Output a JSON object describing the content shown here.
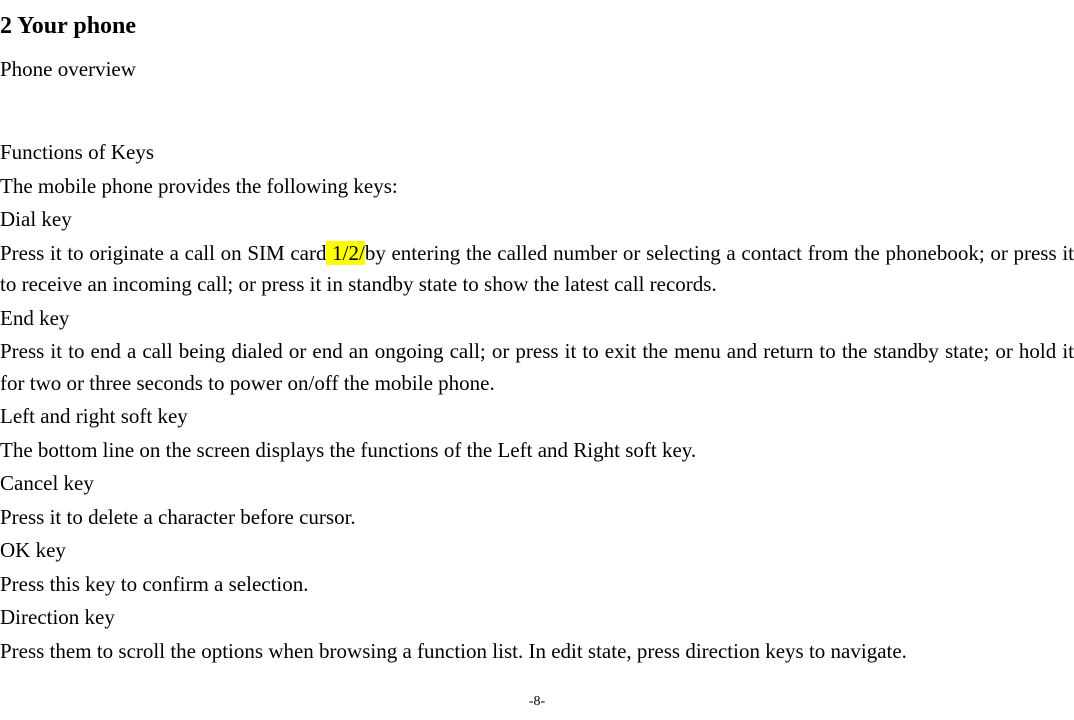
{
  "heading": "2    Your phone",
  "section_title": "Phone overview",
  "functions_heading": "Functions of Keys",
  "intro": "The mobile phone provides the following keys:",
  "keys": {
    "dial": {
      "title": "Dial key",
      "desc_before": "Press it to originate a call on SIM card",
      "highlight": " 1/2/",
      "desc_after": "by entering the called number or selecting a contact from the phonebook; or press it to receive an incoming call; or press it in standby state to show the latest call records."
    },
    "end": {
      "title": "End key",
      "desc": "Press it to end a call being dialed or end an ongoing call; or press it to exit the menu and return to the standby state; or hold it for two or three seconds to power on/off the mobile phone."
    },
    "softkey": {
      "title": "Left and right soft key",
      "desc": "The bottom line on the screen displays the functions of the Left and Right soft key."
    },
    "cancel": {
      "title": "Cancel key",
      "desc": "Press it to delete a character before cursor."
    },
    "ok": {
      "title": "OK key",
      "desc": "Press this key to confirm a selection."
    },
    "direction": {
      "title": "Direction key",
      "desc": "Press them to scroll the options when browsing a function list. In edit state, press direction keys to navigate."
    }
  },
  "page_number": "-8-"
}
